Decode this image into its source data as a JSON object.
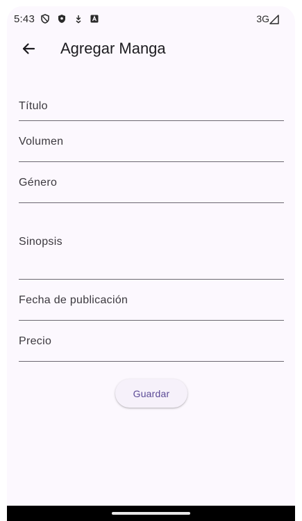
{
  "status_bar": {
    "time": "5:43",
    "network": "3G",
    "icons": [
      "shield-outline-icon",
      "shield-filled-icon",
      "download-icon",
      "app-badge-icon",
      "signal-icon"
    ]
  },
  "app_bar": {
    "back_icon": "arrow-left-icon",
    "title": "Agregar Manga"
  },
  "form": {
    "fields": [
      {
        "label": "Título",
        "value": ""
      },
      {
        "label": "Volumen",
        "value": ""
      },
      {
        "label": "Género",
        "value": ""
      },
      {
        "label": "Sinopsis",
        "value": ""
      },
      {
        "label": "Fecha de publicación",
        "value": ""
      },
      {
        "label": "Precio",
        "value": ""
      }
    ],
    "save_label": "Guardar"
  },
  "colors": {
    "background": "#fcf8fe",
    "accent": "#5b4a96",
    "divider": "#6b6870",
    "text": "#1c1b1f"
  }
}
